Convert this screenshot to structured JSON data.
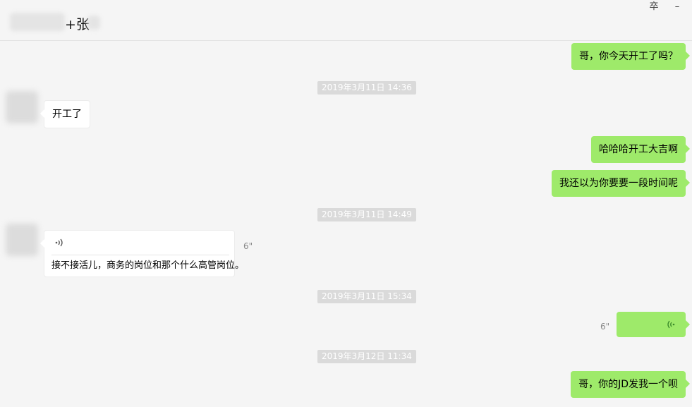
{
  "window": {
    "title": "+张",
    "pin_label": "卒",
    "minimize_label": "–"
  },
  "messages": [
    {
      "type": "text",
      "side": "out",
      "text": "哥，你今天开工了吗？"
    },
    {
      "type": "timestamp",
      "text": "2019年3月11日 14:36"
    },
    {
      "type": "text",
      "side": "in",
      "text": "开工了"
    },
    {
      "type": "text",
      "side": "out",
      "text": "哈哈哈开工大吉啊"
    },
    {
      "type": "text",
      "side": "out",
      "text": "我还以为你要要一段时间呢"
    },
    {
      "type": "timestamp",
      "text": "2019年3月11日 14:49"
    },
    {
      "type": "voice",
      "side": "in",
      "duration": "6\"",
      "transcript": "接不接活儿，商务的岗位和那个什么高管岗位。"
    },
    {
      "type": "timestamp",
      "text": "2019年3月11日 15:34"
    },
    {
      "type": "voice",
      "side": "out",
      "duration": "6\""
    },
    {
      "type": "timestamp",
      "text": "2019年3月12日 11:34"
    },
    {
      "type": "text",
      "side": "out",
      "text": "哥，你的JD发我一个呗"
    }
  ],
  "colors": {
    "outgoing_bubble": "#9eea6a",
    "incoming_bubble": "#ffffff",
    "timestamp_bg": "#dadada",
    "background": "#f5f5f5"
  },
  "icons": {
    "voice_incoming": "voice-wave-icon",
    "voice_outgoing": "voice-wave-icon"
  }
}
